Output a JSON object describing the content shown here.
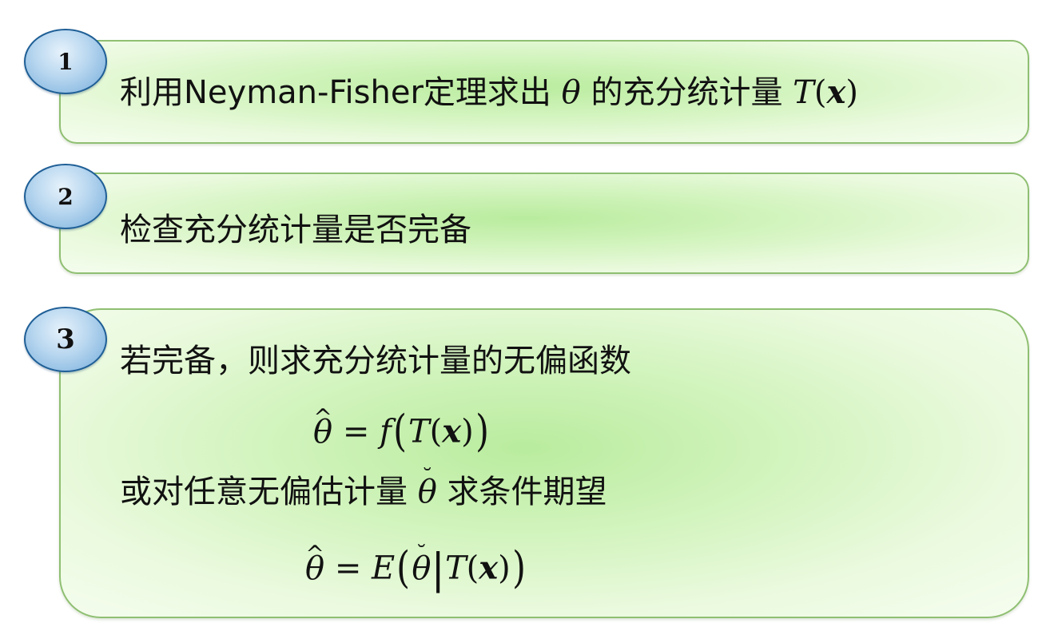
{
  "steps": [
    {
      "number": "1",
      "text_prefix": "利用Neyman-Fisher定理求出",
      "symbol": "θ",
      "text_middle": "的充分统计量",
      "stat_T": "T",
      "stat_x": "x"
    },
    {
      "number": "2",
      "text": "检查充分统计量是否完备"
    },
    {
      "number": "3",
      "line1": "若完备，则求充分统计量的无偏函数",
      "formula1": {
        "lhs": "θ",
        "hat": "^",
        "equals": "=",
        "func": "f",
        "T": "T",
        "x": "x"
      },
      "line2_prefix": "或对任意无偏估计量",
      "line2_symbol": "θ",
      "line2_accent": "˘",
      "line2_suffix": "求条件期望",
      "formula2": {
        "lhs": "θ",
        "hat": "^",
        "equals": "=",
        "func": "E",
        "inner": "θ",
        "inner_accent": "˘",
        "bar": "|",
        "T": "T",
        "x": "x"
      }
    }
  ],
  "colors": {
    "box_border": "#8fbf72",
    "box_fill_center": "#b9ec9e",
    "badge_border": "#1f5f96",
    "badge_fill": "#86b7e0"
  }
}
